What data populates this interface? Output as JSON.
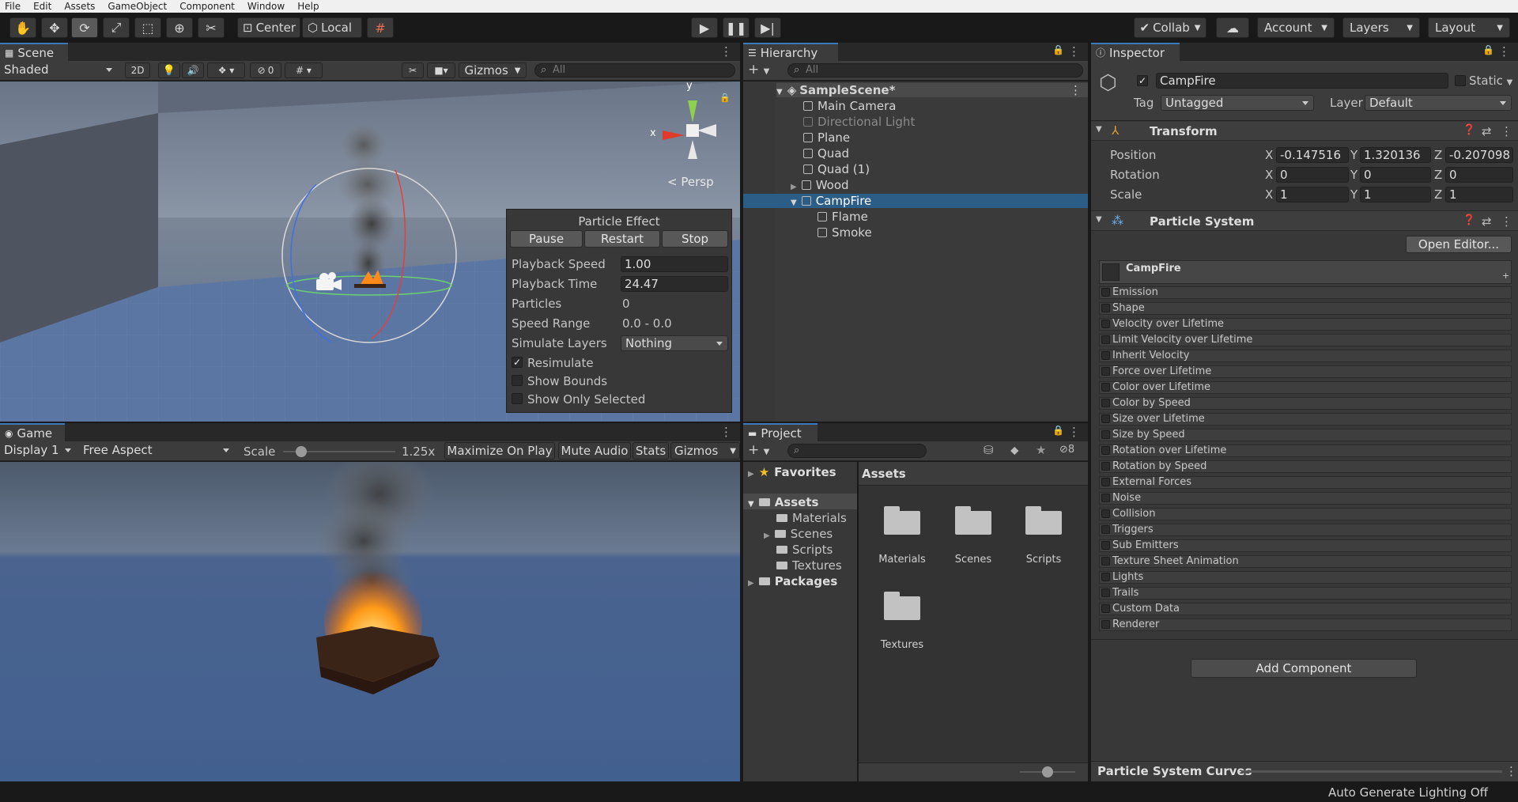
{
  "menu": [
    "File",
    "Edit",
    "Assets",
    "GameObject",
    "Component",
    "Window",
    "Help"
  ],
  "toolbar": {
    "center_label": "Center",
    "local_label": "Local",
    "collab_label": "Collab",
    "account_label": "Account",
    "layers_label": "Layers",
    "layout_label": "Layout"
  },
  "scene": {
    "tab": "Scene",
    "shading": "Shaded",
    "mode_2d": "2D",
    "hidden_count": "0",
    "gizmos": "Gizmos",
    "search_placeholder": "All",
    "persp": "Persp",
    "axis_y": "y",
    "axis_x": "x"
  },
  "particle_effect": {
    "title": "Particle Effect",
    "pause": "Pause",
    "restart": "Restart",
    "stop": "Stop",
    "playback_speed_label": "Playback Speed",
    "playback_speed": "1.00",
    "playback_time_label": "Playback Time",
    "playback_time": "24.47",
    "particles_label": "Particles",
    "particles": "0",
    "speed_range_label": "Speed Range",
    "speed_range": "0.0 - 0.0",
    "simulate_layers_label": "Simulate Layers",
    "simulate_layers": "Nothing",
    "resimulate": "Resimulate",
    "show_bounds": "Show Bounds",
    "show_only_selected": "Show Only Selected"
  },
  "game": {
    "tab": "Game",
    "display": "Display 1",
    "aspect": "Free Aspect",
    "scale_label": "Scale",
    "scale_value": "1.25x",
    "maximize": "Maximize On Play",
    "mute": "Mute Audio",
    "stats": "Stats",
    "gizmos": "Gizmos"
  },
  "hierarchy": {
    "tab": "Hierarchy",
    "search_placeholder": "All",
    "scene_name": "SampleScene*",
    "items": [
      {
        "label": "Main Camera"
      },
      {
        "label": "Directional Light"
      },
      {
        "label": "Plane"
      },
      {
        "label": "Quad"
      },
      {
        "label": "Quad (1)"
      },
      {
        "label": "Wood"
      },
      {
        "label": "CampFire"
      },
      {
        "label": "Flame"
      },
      {
        "label": "Smoke"
      }
    ]
  },
  "project": {
    "tab": "Project",
    "hidden_count": "8",
    "favorites": "Favorites",
    "assets": "Assets",
    "packages": "Packages",
    "tree": [
      "Materials",
      "Scenes",
      "Scripts",
      "Textures"
    ],
    "breadcrumb": "Assets",
    "folders": [
      "Materials",
      "Scenes",
      "Scripts",
      "Textures"
    ]
  },
  "inspector": {
    "tab": "Inspector",
    "object_name": "CampFire",
    "static_label": "Static",
    "tag_label": "Tag",
    "tag_value": "Untagged",
    "layer_label": "Layer",
    "layer_value": "Default",
    "transform_title": "Transform",
    "position_label": "Position",
    "rotation_label": "Rotation",
    "scale_label": "Scale",
    "axis_x": "X",
    "axis_y": "Y",
    "axis_z": "Z",
    "position": [
      "-0.147516",
      "1.320136",
      "-0.207098"
    ],
    "rotation": [
      "0",
      "0",
      "0"
    ],
    "scale": [
      "1",
      "1",
      "1"
    ],
    "particle_system_title": "Particle System",
    "open_editor": "Open Editor...",
    "module_header": "CampFire",
    "modules": [
      "Emission",
      "Shape",
      "Velocity over Lifetime",
      "Limit Velocity over Lifetime",
      "Inherit Velocity",
      "Force over Lifetime",
      "Color over Lifetime",
      "Color by Speed",
      "Size over Lifetime",
      "Size by Speed",
      "Rotation over Lifetime",
      "Rotation by Speed",
      "External Forces",
      "Noise",
      "Collision",
      "Triggers",
      "Sub Emitters",
      "Texture Sheet Animation",
      "Lights",
      "Trails",
      "Custom Data",
      "Renderer"
    ],
    "add_component": "Add Component",
    "curves_title": "Particle System Curves"
  },
  "status": {
    "text": "Auto Generate Lighting Off"
  },
  "colors": {
    "accent": "#3a79bb",
    "selection": "#2c5d87",
    "panel": "#383838"
  }
}
